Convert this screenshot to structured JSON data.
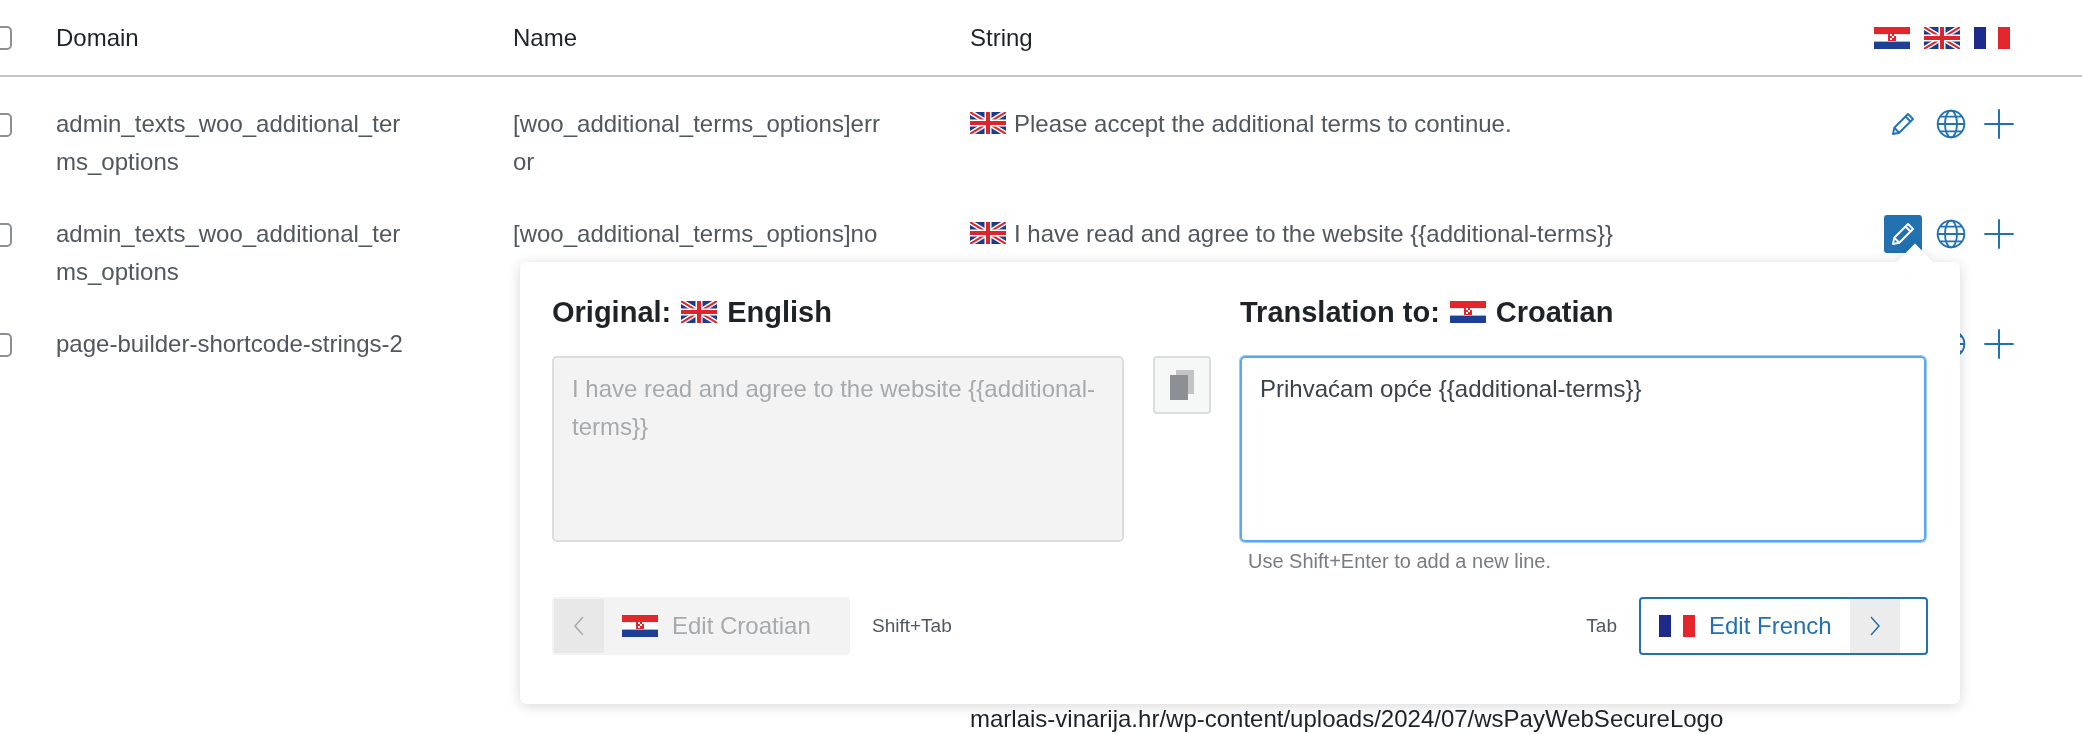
{
  "table": {
    "header": {
      "checked": false,
      "columns": [
        "Domain",
        "Name",
        "String"
      ]
    },
    "rows": [
      {
        "checked": false,
        "domain": "admin_texts_woo_additional_terms_options",
        "name": "[woo_additional_terms_options]error",
        "flag_shown": true,
        "string": "Please accept the additional terms to continue.",
        "actions": [
          {
            "kind": "edit",
            "selected": false
          },
          {
            "kind": "translate"
          },
          {
            "kind": "add"
          }
        ]
      },
      {
        "checked": false,
        "domain": "admin_texts_woo_additional_terms_options",
        "name": "[woo_additional_terms_options]no",
        "flag_shown": true,
        "string": "I have read and agree to the website {{additional-terms}}",
        "actions": [
          {
            "kind": "edit",
            "selected": true
          },
          {
            "kind": "translate"
          },
          {
            "kind": "add"
          }
        ]
      },
      {
        "checked": false,
        "domain": "page-builder-shortcode-strings-2",
        "flag_shown": false,
        "string": "marlais-vinarija.hr/wp-content/uploads/2024/07/wsPayWebSecureLogo",
        "actions": [
          {
            "kind": "translate"
          },
          {
            "kind": "add"
          }
        ]
      }
    ]
  },
  "popup": {
    "original_label": "Original:",
    "original_language": "English",
    "translation_label": "Translation to:",
    "translation_language": "Croatian",
    "original_text": "I have read and agree to the website {{additional-terms}}",
    "translation_text": "Prihvaćam opće {{additional-terms}}",
    "hint": "Use Shift+Enter to add a new line.",
    "prev": {
      "label": "Edit Croatian",
      "disabled": true
    },
    "prev_shortcut": "Shift+Tab",
    "next_shortcut": "Tab",
    "next": {
      "label": "Edit French",
      "disabled": false
    }
  }
}
